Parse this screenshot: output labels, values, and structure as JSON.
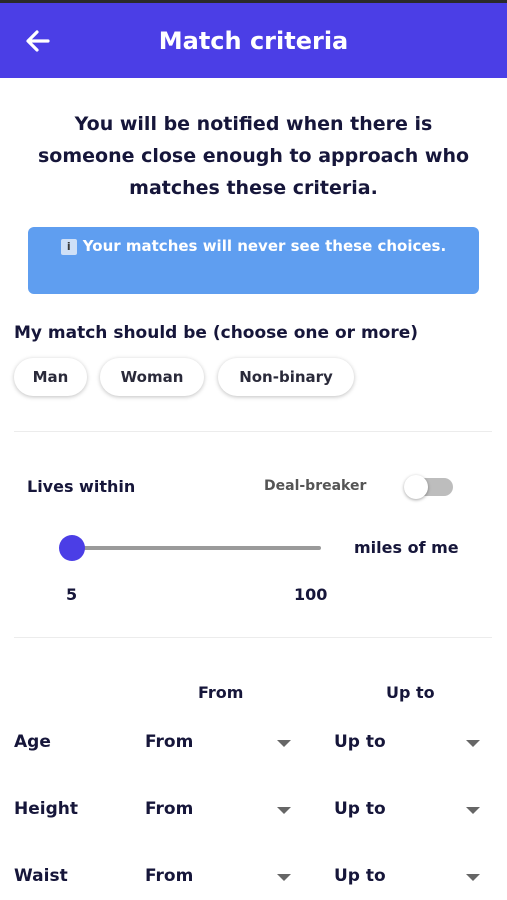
{
  "header": {
    "title": "Match criteria",
    "back_icon": "arrow-left-icon"
  },
  "notice": {
    "line1": "You will be notified when there is",
    "line2": "someone close enough to approach who",
    "line3": "matches these criteria."
  },
  "info": {
    "icon": "info-icon",
    "icon_glyph": "i",
    "text": "Your matches will never see these choices."
  },
  "gender": {
    "label": "My match should be (choose one or more)",
    "options": [
      {
        "label": "Man"
      },
      {
        "label": "Woman"
      },
      {
        "label": "Non-binary"
      }
    ]
  },
  "distance": {
    "label": "Lives within",
    "deal_breaker_label": "Deal-breaker",
    "deal_breaker_on": false,
    "slider_value": 5,
    "min_label": "5",
    "max_label": "100",
    "unit_label": "miles of me"
  },
  "ranges": {
    "from_header": "From",
    "upto_header": "Up to",
    "rows": [
      {
        "label": "Age",
        "from": "From",
        "upto": "Up to"
      },
      {
        "label": "Height",
        "from": "From",
        "upto": "Up to"
      },
      {
        "label": "Waist",
        "from": "From",
        "upto": "Up to"
      }
    ]
  },
  "colors": {
    "primary": "#4b3ee6",
    "info_bg": "#5f9ef0",
    "text": "#16163a"
  }
}
